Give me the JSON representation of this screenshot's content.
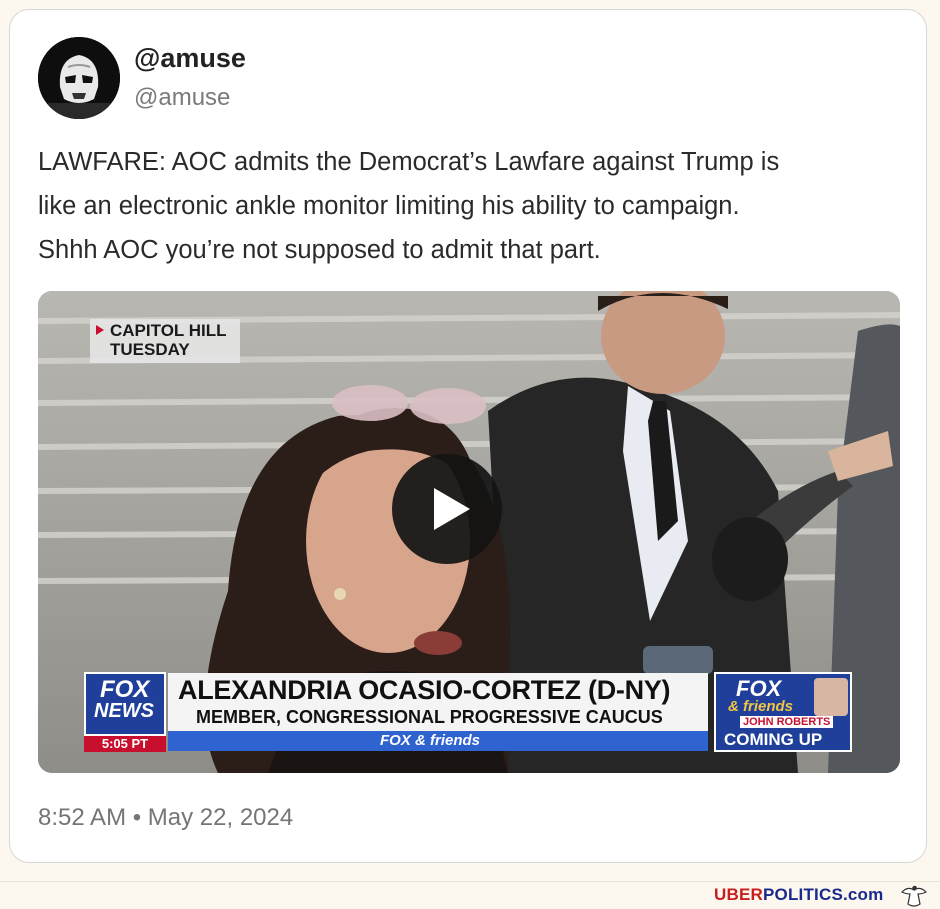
{
  "tweet": {
    "display_name": "@amuse",
    "handle": "@amuse",
    "text_lines": [
      "LAWFARE: AOC admits the Democrat’s Lawfare against Trump is",
      "like an electronic ankle monitor limiting his ability to campaign.",
      "Shhh AOC you’re not supposed to admit that part."
    ],
    "timestamp": "8:52 AM • May 22, 2024"
  },
  "video": {
    "location_tag_line1": "CAPITOL HILL",
    "location_tag_line2": "TUESDAY",
    "network_logo_line1": "FOX",
    "network_logo_line2": "NEWS",
    "broadcast_time": "5:05 PT",
    "lower_third_name": "ALEXANDRIA OCASIO-CORTEZ (D-NY)",
    "lower_third_title": "MEMBER, CONGRESSIONAL PROGRESSIVE CAUCUS",
    "show_bug": "FOX & friends",
    "promo_logo_line1": "FOX",
    "promo_logo_line2": "& friends",
    "promo_host": "JOHN ROBERTS",
    "promo_label": "COMING UP",
    "play_icon": "play-icon"
  },
  "footer": {
    "watermark_part1": "UBER",
    "watermark_part2": "POLITICS",
    "watermark_part3": ".com",
    "logo_icon": "eagle-icon"
  },
  "colors": {
    "fox_blue": "#1f3f9a",
    "fox_red": "#c8102e",
    "watermark_red": "#c81e1e",
    "watermark_blue": "#1a2a8a"
  }
}
